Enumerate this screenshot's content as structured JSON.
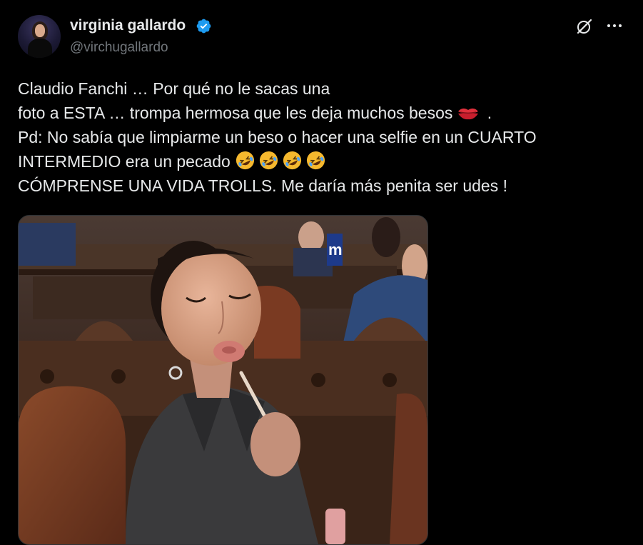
{
  "author": {
    "display_name": "virginia gallardo",
    "handle": "@virchugallardo",
    "verified": true,
    "verified_color": "#1d9bf0"
  },
  "header_icons": [
    "grok-icon",
    "more-icon"
  ],
  "tweet": {
    "lines": [
      "Claudio Fanchi … Por qué no le sacas una",
      "foto a ESTA … trompa hermosa que les deja muchos besos",
      " .",
      "Pd: No sabía que limpiarme un beso o hacer una selfie en un CUARTO",
      "INTERMEDIO era un pecado",
      "CÓMPRENSE UNA VIDA TROLLS. Me daría más penita ser udes !"
    ],
    "emojis": [
      "kiss-mark-emoji",
      "rofl-emoji"
    ]
  },
  "media": {
    "type": "photo",
    "overlay_text": "m"
  },
  "colors": {
    "background": "#000000",
    "text": "#e7e9ea",
    "secondary": "#71767b",
    "accent": "#1d9bf0"
  }
}
